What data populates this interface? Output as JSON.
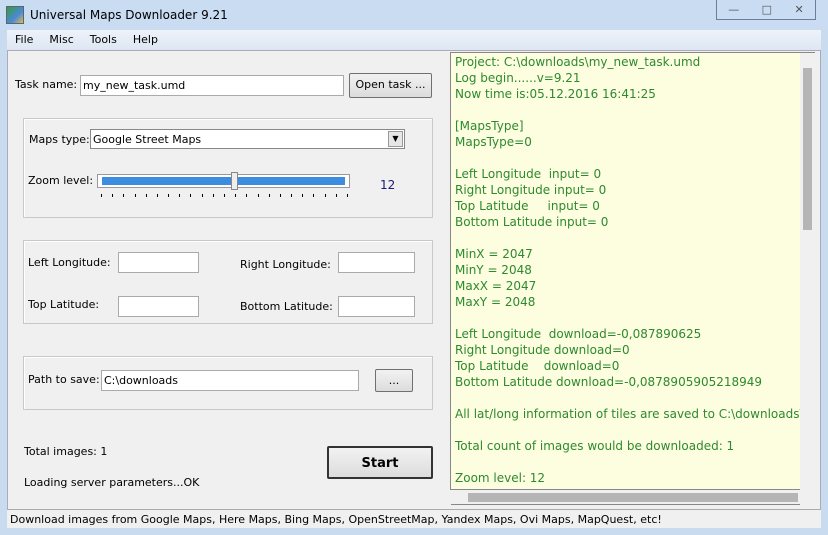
{
  "window": {
    "title": "Universal Maps Downloader 9.21",
    "controls": [
      "—",
      "□",
      "✕"
    ]
  },
  "menu": [
    "File",
    "Misc",
    "Tools",
    "Help"
  ],
  "task": {
    "label": "Task name:",
    "value": "my_new_task.umd",
    "open_button": "Open task ..."
  },
  "maps": {
    "type_label": "Maps type:",
    "type_value": "Google Street Maps",
    "zoom_label": "Zoom level:",
    "zoom_value": "12",
    "zoom_min": 0,
    "zoom_max": 22
  },
  "coords": {
    "left_label": "Left Longitude:",
    "right_label": "Right Longitude:",
    "top_label": "Top Latitude:",
    "bottom_label": "Bottom Latitude:",
    "left": "",
    "right": "",
    "top": "",
    "bottom": ""
  },
  "path": {
    "label": "Path to save:",
    "value": "C:\\downloads",
    "browse": "..."
  },
  "summary": {
    "total_images": "Total images: 1",
    "loading": "Loading server parameters...OK",
    "start": "Start"
  },
  "log": "Project: C:\\downloads\\my_new_task.umd\nLog begin......v=9.21\nNow time is:05.12.2016 16:41:25\n\n[MapsType]\nMapsType=0\n\nLeft Longitude  input= 0\nRight Longitude input= 0\nTop Latitude     input= 0\nBottom Latitude input= 0\n\nMinX = 2047\nMinY = 2048\nMaxX = 2047\nMaxY = 2048\n\nLeft Longitude  download=-0,087890625\nRight Longitude download=0\nTop Latitude    download=0\nBottom Latitude download=-0,0878905905218949\n\nAll lat/long information of tiles are saved to C:\\downloads\\my\n\nTotal count of images would be downloaded: 1\n\nZoom level: 12",
  "statusbar": "Download images from Google Maps, Here Maps, Bing Maps, OpenStreetMap, Yandex Maps, Ovi Maps, MapQuest, etc!"
}
